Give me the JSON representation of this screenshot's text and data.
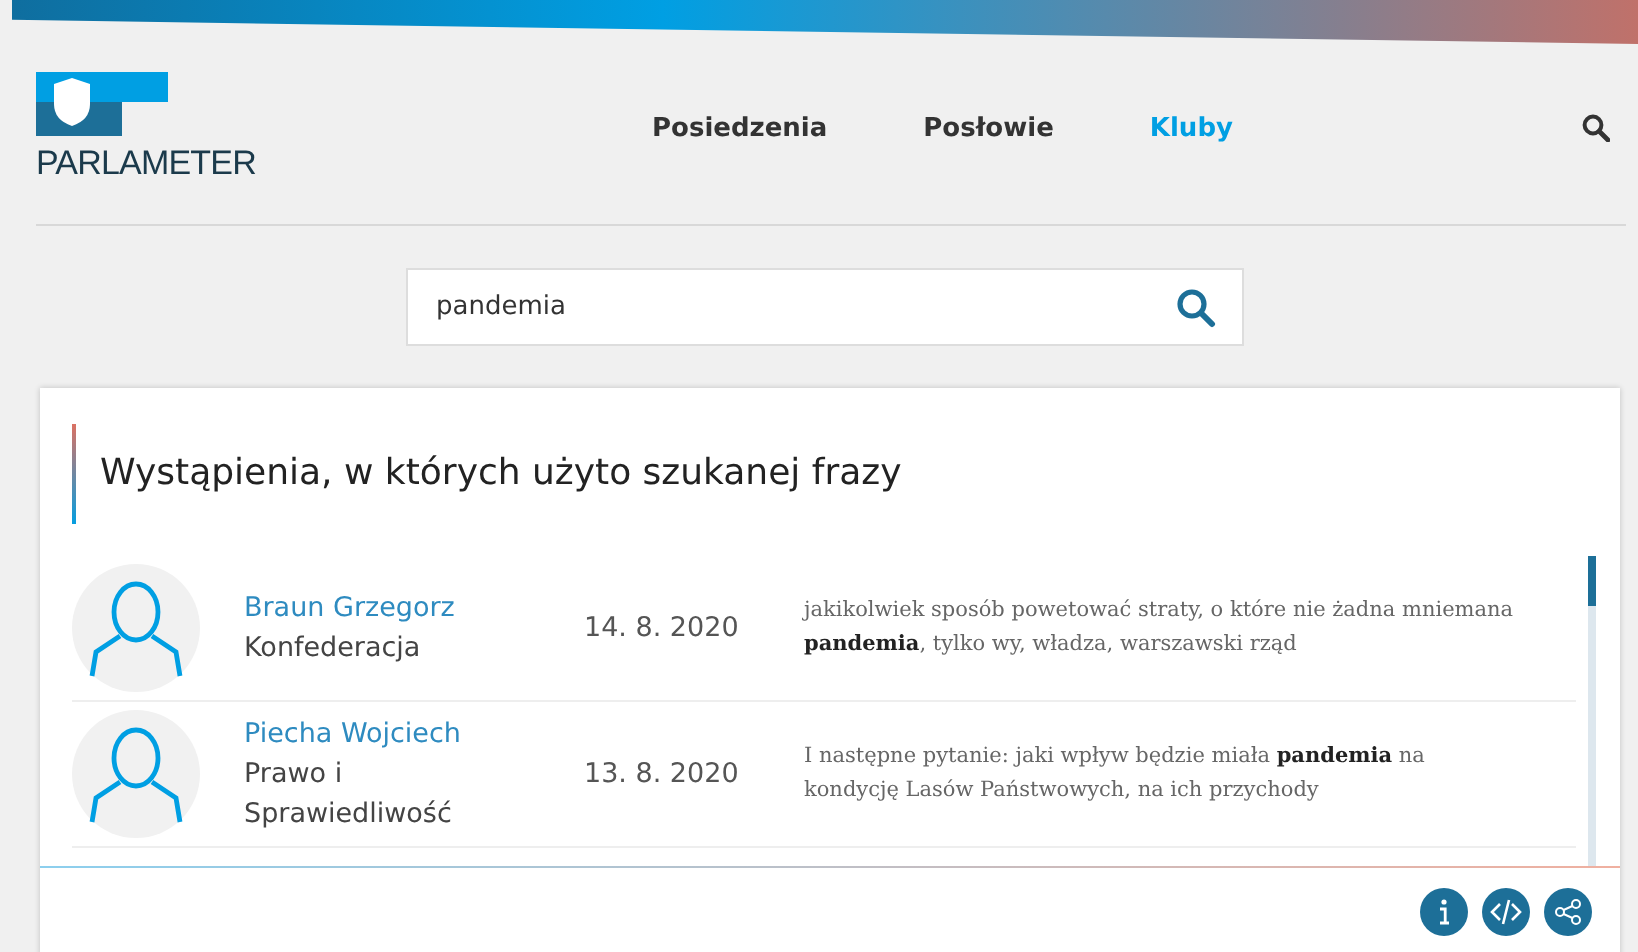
{
  "logo": {
    "text": "PARLAMETER"
  },
  "nav": [
    {
      "label": "Posiedzenia",
      "selected": false
    },
    {
      "label": "Posłowie",
      "selected": false
    },
    {
      "label": "Kluby",
      "selected": true
    }
  ],
  "search": {
    "value": "pandemia"
  },
  "card": {
    "title": "Wystąpienia, w których użyto szukanej frazy",
    "rows": [
      {
        "name": "Braun Grzegorz",
        "party": "Konfederacja",
        "date": "14. 8. 2020",
        "quote": "jakikolwiek sposób powetować straty, o które nie żadna mniemana **pandemia**, tylko wy, władza, warszawski rząd"
      },
      {
        "name": "Piecha Wojciech",
        "party": "Prawo i Sprawiedliwość",
        "date": "13. 8. 2020",
        "quote": "I następne pytanie: jaki wpływ będzie miała **pandemia** na kondycję Lasów Państwowych, na ich przychody"
      }
    ]
  }
}
